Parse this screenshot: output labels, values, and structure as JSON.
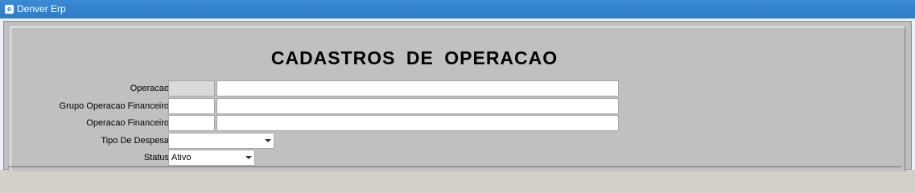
{
  "window": {
    "title": "Denver Erp"
  },
  "form": {
    "title": "CADASTROS  DE  OPERACAO",
    "operacao": {
      "label": "Operacao",
      "code": "",
      "description": ""
    },
    "grupo_operacao_financeiro": {
      "label": "Grupo Operacao Financeiro",
      "code": "",
      "description": ""
    },
    "operacao_financeiro": {
      "label": "Operacao Financeiro",
      "code": "",
      "description": ""
    },
    "tipo_de_despesa": {
      "label": "Tipo De Despesa",
      "value": ""
    },
    "status": {
      "label": "Status",
      "value": "Ativo"
    }
  }
}
